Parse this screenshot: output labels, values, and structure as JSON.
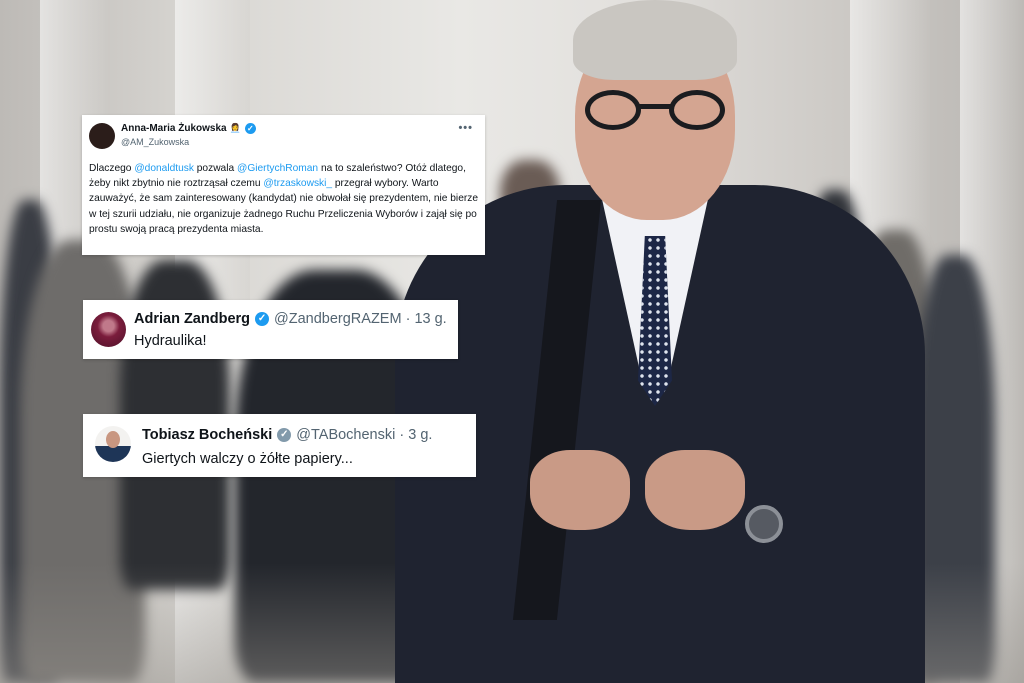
{
  "colors": {
    "mention": "#1d9bf0",
    "verified": "#1d9bf0",
    "verified_gray": "#829aab",
    "handle": "#536471",
    "text": "#0f1419"
  },
  "tweets": [
    {
      "name": "Anna-Maria Żukowska",
      "handle": "@AM_Zukowska",
      "verified": true,
      "body": [
        {
          "t": "Dlaczego "
        },
        {
          "t": "@donaldtusk",
          "m": true
        },
        {
          "t": " pozwala "
        },
        {
          "t": "@GiertychRoman",
          "m": true
        },
        {
          "t": " na to szaleństwo? Otóż dlatego, żeby nikt zbytnio nie roztrząsał czemu "
        },
        {
          "t": "@trzaskowski_",
          "m": true
        },
        {
          "t": " przegrał wybory. Warto zauważyć, że sam zainteresowany (kandydat) nie obwołał się prezydentem, nie bierze w tej szurii udziału, nie organizuje żadnego Ruchu Przeliczenia Wyborów i zajął się po prostu swoją pracą prezydenta miasta."
        }
      ]
    },
    {
      "name": "Adrian Zandberg",
      "handle": "@ZandbergRAZEM",
      "time": "13 g.",
      "verified": true,
      "text": "Hydraulika!"
    },
    {
      "name": "Tobiasz Bocheński",
      "handle": "@TABochenski",
      "time": "3 g.",
      "verified": true,
      "text": "Giertych walczy o żółte papiery..."
    }
  ],
  "icons": {
    "verified": "verified-badge-icon",
    "more": "more-options-icon",
    "emoji": "woman-emoji-icon"
  }
}
